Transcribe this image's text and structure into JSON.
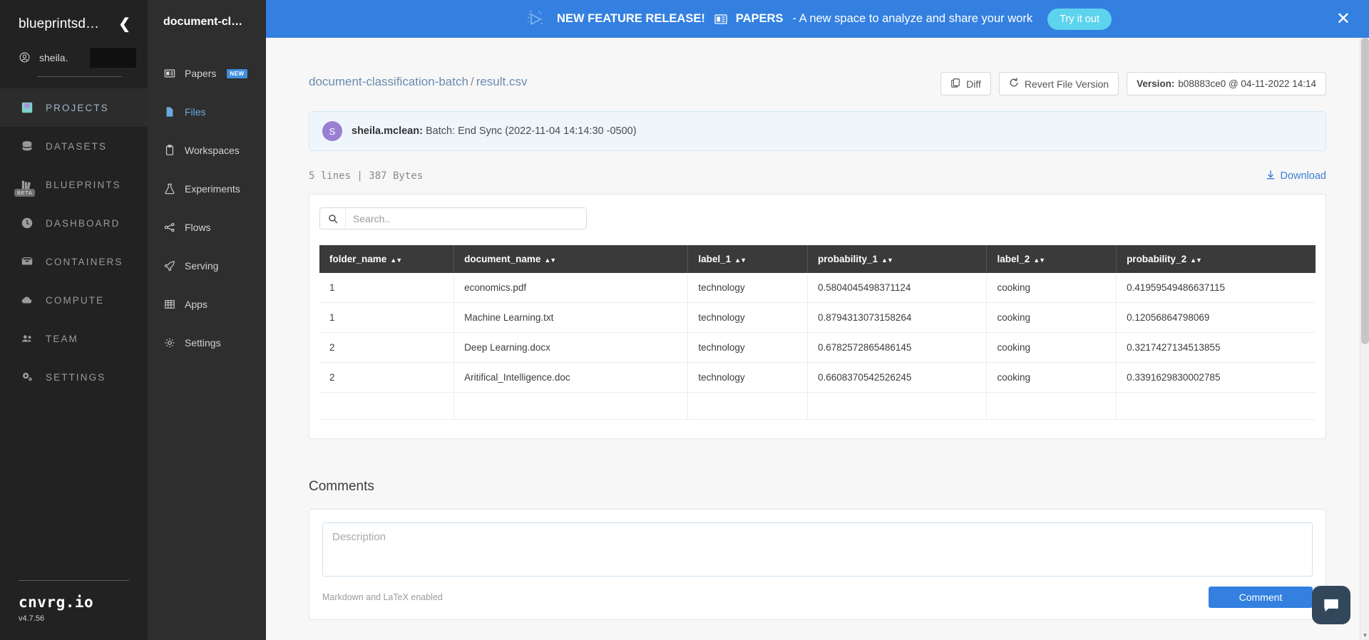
{
  "sidebar": {
    "org_name": "blueprintsd…",
    "user_name": "sheila.",
    "collapse_icon": "chevron-left-icon",
    "items": [
      {
        "label": "PROJECTS",
        "icon": "projects-icon",
        "active": true,
        "badge": ""
      },
      {
        "label": "DATASETS",
        "icon": "datasets-icon",
        "active": false,
        "badge": ""
      },
      {
        "label": "BLUEPRINTS",
        "icon": "blueprints-icon",
        "active": false,
        "badge": "BETA"
      },
      {
        "label": "DASHBOARD",
        "icon": "dashboard-icon",
        "active": false,
        "badge": ""
      },
      {
        "label": "CONTAINERS",
        "icon": "containers-icon",
        "active": false,
        "badge": ""
      },
      {
        "label": "COMPUTE",
        "icon": "compute-icon",
        "active": false,
        "badge": ""
      },
      {
        "label": "TEAM",
        "icon": "team-icon",
        "active": false,
        "badge": ""
      },
      {
        "label": "SETTINGS",
        "icon": "settings-icon",
        "active": false,
        "badge": ""
      }
    ],
    "brand": "cnvrg.io",
    "version": "v4.7.56"
  },
  "project_nav": {
    "title": "document-cl…",
    "items": [
      {
        "label": "Papers",
        "icon": "papers-icon",
        "tag": "NEW",
        "active": false
      },
      {
        "label": "Files",
        "icon": "file-icon",
        "tag": "",
        "active": true
      },
      {
        "label": "Workspaces",
        "icon": "workspaces-icon",
        "tag": "",
        "active": false
      },
      {
        "label": "Experiments",
        "icon": "experiments-icon",
        "tag": "",
        "active": false
      },
      {
        "label": "Flows",
        "icon": "flows-icon",
        "tag": "",
        "active": false
      },
      {
        "label": "Serving",
        "icon": "serving-icon",
        "tag": "",
        "active": false
      },
      {
        "label": "Apps",
        "icon": "apps-icon",
        "tag": "",
        "active": false
      },
      {
        "label": "Settings",
        "icon": "gear-icon",
        "tag": "",
        "active": false
      }
    ]
  },
  "promo": {
    "headline": "NEW FEATURE RELEASE!",
    "product": "PAPERS",
    "tagline": "- A new space to analyze and share your work",
    "cta_label": "Try it out",
    "close_icon": "close-icon",
    "bg_color": "#3380e0",
    "cta_color": "#5dd3ee"
  },
  "file_page": {
    "breadcrumb_project": "document-classification-batch",
    "breadcrumb_sep": "/",
    "breadcrumb_file": "result.csv",
    "diff_label": "Diff",
    "revert_label": "Revert File Version",
    "version_label": "Version:",
    "version_value": "b08883ce0 @ 04-11-2022 14:14",
    "commit_author": "sheila.mclean:",
    "commit_message": " Batch: End Sync (2022-11-04 14:14:30 -0500)",
    "avatar_initial": "S",
    "avatar_color": "#9a7fd4",
    "file_meta": "5 lines | 387 Bytes",
    "download_label": "Download",
    "search_placeholder": "Search..",
    "search_value": ""
  },
  "table": {
    "columns": [
      "folder_name",
      "document_name",
      "label_1",
      "probability_1",
      "label_2",
      "probability_2"
    ],
    "rows": [
      [
        "1",
        "economics.pdf",
        "technology",
        "0.5804045498371124",
        "cooking",
        "0.41959549486637115"
      ],
      [
        "1",
        "Machine Learning.txt",
        "technology",
        "0.8794313073158264",
        "cooking",
        "0.12056864798069"
      ],
      [
        "2",
        "Deep Learning.docx",
        "technology",
        "0.6782572865486145",
        "cooking",
        "0.3217427134513855"
      ],
      [
        "2",
        "Aritifical_Intelligence.doc",
        "technology",
        "0.6608370542526245",
        "cooking",
        "0.3391629830002785"
      ],
      [
        "",
        "",
        "",
        "",
        "",
        ""
      ]
    ]
  },
  "comments": {
    "title": "Comments",
    "placeholder": "Description",
    "value": "",
    "hint": "Markdown and LaTeX enabled",
    "submit_label": "Comment"
  }
}
